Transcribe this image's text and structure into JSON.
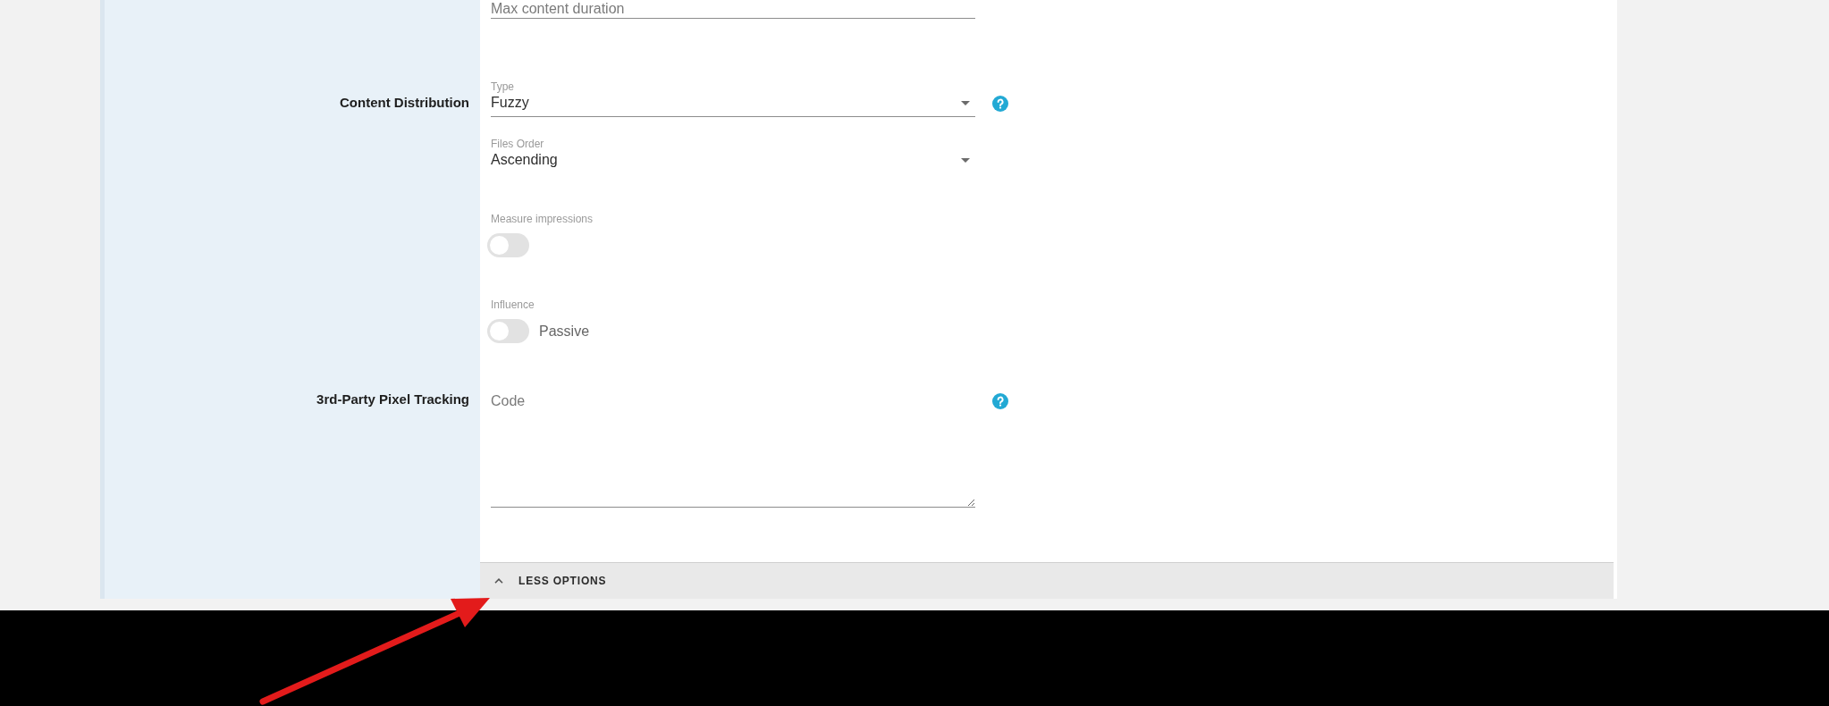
{
  "sections": [
    {
      "fields": [
        {
          "kind": "input",
          "placeholder": "Max content duration",
          "help": false
        }
      ]
    },
    {
      "label": "Content Distribution",
      "fields": [
        {
          "kind": "select",
          "label": "Type",
          "value": "Fuzzy",
          "underlined": true,
          "help": true
        },
        {
          "kind": "select",
          "label": "Files Order",
          "value": "Ascending",
          "underlined": false,
          "help": false
        },
        {
          "kind": "toggle",
          "label": "Measure impressions",
          "on": false,
          "help": false
        },
        {
          "kind": "toggle",
          "label": "Influence",
          "on": false,
          "state_text": "Passive",
          "help": false
        }
      ]
    },
    {
      "label": "3rd-Party Pixel Tracking",
      "fields": [
        {
          "kind": "textarea",
          "placeholder": "Code",
          "help": true
        }
      ]
    }
  ],
  "footer": {
    "button": "LESS OPTIONS",
    "expanded": true
  }
}
